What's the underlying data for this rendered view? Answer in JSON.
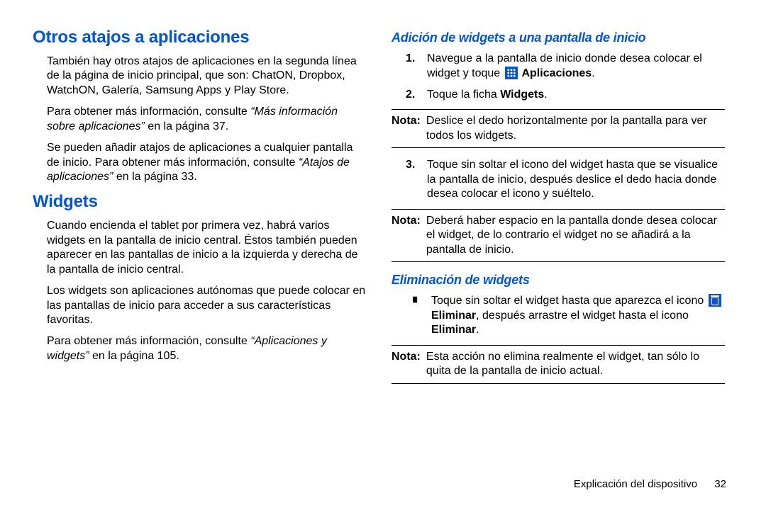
{
  "left": {
    "h1_otros": "Otros atajos a aplicaciones",
    "p1": "También hay otros atajos de aplicaciones en la segunda línea de la página de inicio principal, que son: ChatON, Dropbox, WatchON, Galería, Samsung Apps y Play Store.",
    "p2_a": "Para obtener más información, consulte ",
    "p2_ref": "“Más información sobre aplicaciones”",
    "p2_b": "  en la página 37.",
    "p3_a": "Se pueden añadir atajos de aplicaciones a cualquier pantalla de inicio. Para obtener más información, consulte ",
    "p3_ref": "“Atajos de aplicaciones”",
    "p3_b": "  en la página 33.",
    "h1_widgets": "Widgets",
    "p4": "Cuando encienda el tablet por primera vez, habrá varios widgets en la pantalla de inicio central. Éstos también pueden aparecer en las pantallas de inicio a la izquierda y derecha de la pantalla de inicio central.",
    "p5": "Los widgets son aplicaciones autónomas que puede colocar en las pantallas de inicio para acceder a sus características favoritas.",
    "p6_a": "Para obtener más información, consulte ",
    "p6_ref": "“Aplicaciones y widgets”",
    "p6_b": "  en la página 105."
  },
  "right": {
    "h2_add": "Adición de widgets a una pantalla de inicio",
    "step1_num": "1.",
    "step1_a": "Navegue a la pantalla de inicio donde desea colocar el widget y toque ",
    "step1_b": " Aplicaciones",
    "step1_c": ".",
    "step2_num": "2.",
    "step2_a": "Toque la ficha ",
    "step2_b": "Widgets",
    "step2_c": ".",
    "note1_label": "Nota:",
    "note1_body": "Deslice el dedo horizontalmente por la pantalla para ver todos los widgets.",
    "step3_num": "3.",
    "step3_body": "Toque sin soltar el icono del widget hasta que se visualice la pantalla de inicio, después deslice el dedo hacia donde desea colocar el icono y suéltelo.",
    "note2_label": "Nota:",
    "note2_body": "Deberá haber espacio en la pantalla donde desea colocar el widget, de lo contrario el widget no se añadirá a la pantalla de inicio.",
    "h2_del": "Eliminación de widgets",
    "bullet_mark": "∎",
    "bullet_a": "Toque sin soltar el widget hasta que aparezca el icono ",
    "bullet_b": " Eliminar",
    "bullet_c": ", después arrastre el widget hasta el icono ",
    "bullet_d": "Eliminar",
    "bullet_e": ".",
    "note3_label": "Nota:",
    "note3_body": "Esta acción no elimina realmente el widget, tan sólo lo quita de la pantalla de inicio actual."
  },
  "footer": {
    "section": "Explicación del dispositivo",
    "page": "32"
  }
}
